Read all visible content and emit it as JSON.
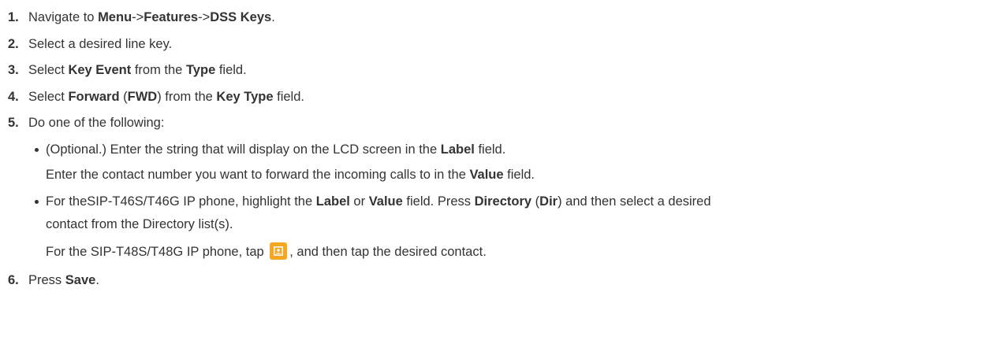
{
  "steps": [
    {
      "num": "1.",
      "parts": [
        "Navigate to ",
        "Menu",
        "->",
        "Features",
        "->",
        "DSS Keys",
        "."
      ]
    },
    {
      "num": "2.",
      "parts": [
        "Select a desired line key."
      ]
    },
    {
      "num": "3.",
      "parts": [
        "Select ",
        "Key Event",
        " from the ",
        "Type",
        " field."
      ]
    },
    {
      "num": "4.",
      "parts": [
        "Select ",
        "Forward",
        " (",
        "FWD",
        ") from the ",
        "Key Type",
        " field."
      ]
    },
    {
      "num": "5.",
      "parts": [
        "Do one of the following:"
      ]
    },
    {
      "num": "6.",
      "parts": [
        "Press ",
        "Save",
        "."
      ]
    }
  ],
  "bullets": [
    {
      "line1": [
        "(Optional.) Enter the string that will display on the LCD screen in the ",
        "Label",
        " field."
      ],
      "line2": [
        "Enter the contact number you want to forward the incoming calls to in the ",
        "Value",
        " field."
      ]
    },
    {
      "line1": [
        "For theSIP-T46S/T46G IP phone, highlight the ",
        "Label",
        " or ",
        "Value",
        " field. Press ",
        "Directory",
        " (",
        "Dir",
        ") and then select a desired"
      ],
      "line2": [
        "contact from the Directory list(s)."
      ],
      "line3": [
        "For the SIP-T48S/T48G IP phone, tap ",
        ", and then tap the desired contact."
      ]
    }
  ],
  "icons": {
    "contact_button": "contacts-icon",
    "contact_button_color": "#f5a623"
  }
}
